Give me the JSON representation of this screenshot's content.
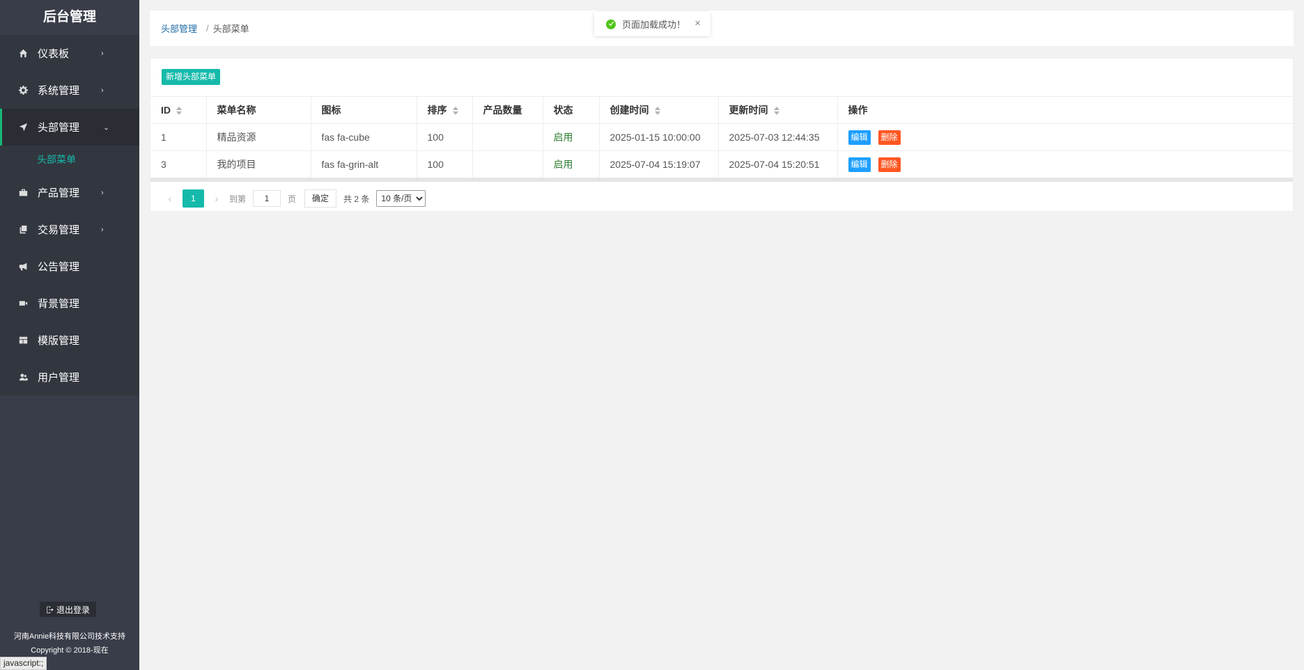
{
  "sidebar": {
    "title": "后台管理",
    "items": [
      {
        "label": "仪表板",
        "icon": "home-icon",
        "arrow": "›"
      },
      {
        "label": "系统管理",
        "icon": "gear-icon",
        "arrow": "›"
      },
      {
        "label": "头部管理",
        "icon": "send-icon",
        "arrow": "⌄"
      },
      {
        "label": "产品管理",
        "icon": "briefcase-icon",
        "arrow": "›"
      },
      {
        "label": "交易管理",
        "icon": "copy-icon",
        "arrow": "›"
      },
      {
        "label": "公告管理",
        "icon": "megaphone-icon",
        "arrow": ""
      },
      {
        "label": "背景管理",
        "icon": "video-icon",
        "arrow": ""
      },
      {
        "label": "模版管理",
        "icon": "template-icon",
        "arrow": ""
      },
      {
        "label": "用户管理",
        "icon": "users-icon",
        "arrow": ""
      }
    ],
    "sub_item": "头部菜单",
    "logout": "退出登录",
    "footer_company": "河南Annie科技有限公司技术支持",
    "footer_copyright": "Copyright © 2018-现在"
  },
  "status_bar": "javascript:;",
  "breadcrumb": {
    "parent": "头部管理",
    "separator": "/",
    "current": "头部菜单"
  },
  "toast": {
    "message": "页面加载成功！",
    "close": "×"
  },
  "toolbar": {
    "add_label": "新增头部菜单"
  },
  "table": {
    "headers": [
      "ID",
      "菜单名称",
      "图标",
      "排序",
      "产品数量",
      "状态",
      "创建时间",
      "更新时间",
      "操作"
    ],
    "rows": [
      {
        "id": "1",
        "name": "精品资源",
        "icon": "fas fa-cube",
        "sort": "100",
        "count": "",
        "status": "启用",
        "created": "2025-01-15 10:00:00",
        "updated": "2025-07-03 12:44:35"
      },
      {
        "id": "3",
        "name": "我的项目",
        "icon": "fas fa-grin-alt",
        "sort": "100",
        "count": "",
        "status": "启用",
        "created": "2025-07-04 15:19:07",
        "updated": "2025-07-04 15:20:51"
      }
    ],
    "edit_label": "编辑",
    "delete_label": "删除"
  },
  "pagination": {
    "prev": "‹",
    "current": "1",
    "next": "›",
    "goto_label": "到第",
    "goto_value": "1",
    "page_label": "页",
    "confirm_label": "确定",
    "total_label": "共 2 条",
    "page_size": "10 条/页"
  },
  "colors": {
    "sidebar_bg": "#393d49",
    "accent": "#16baaa",
    "edit": "#1e9fff",
    "delete": "#ff5722",
    "success": "#52c41a"
  }
}
